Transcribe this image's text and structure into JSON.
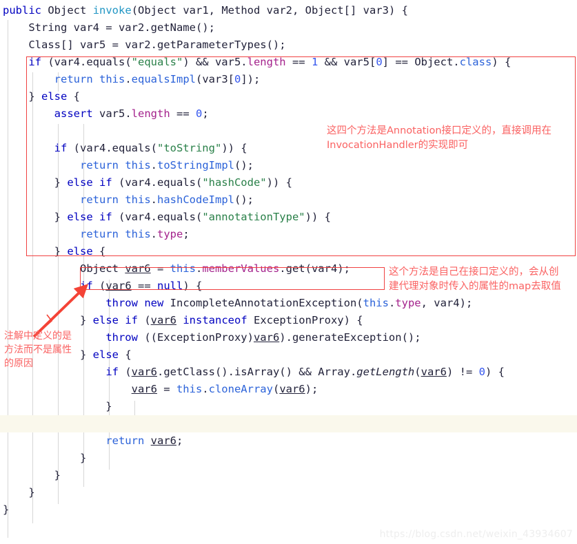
{
  "editor": {
    "language": "java",
    "background": "#ffffff",
    "highlighted_line_color": "#faf8ec",
    "lines": [
      {
        "indent": 0,
        "text": "public Object invoke(Object var1, Method var2, Object[] var3) {"
      },
      {
        "indent": 1,
        "text": "String var4 = var2.getName();"
      },
      {
        "indent": 1,
        "text": "Class[] var5 = var2.getParameterTypes();"
      },
      {
        "indent": 1,
        "text": "if (var4.equals(\"equals\") && var5.length == 1 && var5[0] == Object.class) {"
      },
      {
        "indent": 2,
        "text": "return this.equalsImpl(var3[0]);"
      },
      {
        "indent": 1,
        "text": "} else {"
      },
      {
        "indent": 2,
        "text": "assert var5.length == 0;"
      },
      {
        "indent": 0,
        "text": ""
      },
      {
        "indent": 2,
        "text": "if (var4.equals(\"toString\")) {"
      },
      {
        "indent": 3,
        "text": "return this.toStringImpl();"
      },
      {
        "indent": 2,
        "text": "} else if (var4.equals(\"hashCode\")) {"
      },
      {
        "indent": 3,
        "text": "return this.hashCodeImpl();"
      },
      {
        "indent": 2,
        "text": "} else if (var4.equals(\"annotationType\")) {"
      },
      {
        "indent": 3,
        "text": "return this.type;"
      },
      {
        "indent": 2,
        "text": "} else {"
      },
      {
        "indent": 3,
        "text": "Object var6 = this.memberValues.get(var4);"
      },
      {
        "indent": 3,
        "text": "if (var6 == null) {"
      },
      {
        "indent": 4,
        "text": "throw new IncompleteAnnotationException(this.type, var4);"
      },
      {
        "indent": 3,
        "text": "} else if (var6 instanceof ExceptionProxy) {"
      },
      {
        "indent": 4,
        "text": "throw ((ExceptionProxy)var6).generateException();"
      },
      {
        "indent": 3,
        "text": "} else {"
      },
      {
        "indent": 4,
        "text": "if (var6.getClass().isArray() && Array.getLength(var6) != 0) {"
      },
      {
        "indent": 5,
        "text": "var6 = this.cloneArray(var6);"
      },
      {
        "indent": 4,
        "text": "}"
      },
      {
        "indent": 0,
        "text": ""
      },
      {
        "indent": 4,
        "text": "return var6;"
      },
      {
        "indent": 3,
        "text": "}"
      },
      {
        "indent": 2,
        "text": "}"
      },
      {
        "indent": 1,
        "text": "}"
      },
      {
        "indent": 0,
        "text": "}"
      }
    ],
    "highlighted_line_index": 24
  },
  "annotations": {
    "color": "#fa6262",
    "box_color": "#f04040",
    "items": [
      {
        "id": "annotation-annotation-interface",
        "text": "这四个方法是Annotation接口定义的，直接调用在\nInvocationHandler的实现即可"
      },
      {
        "id": "annotation-member-values",
        "text": "这个方法是自己在接口定义的，会从创\n建代理对象时传入的属性的map去取值"
      },
      {
        "id": "annotation-method-not-field",
        "text": "注解中定义的是\n方法而不是属性\n的原因"
      }
    ]
  },
  "watermark": {
    "text": "https://blog.csdn.net/weixin_43934607"
  }
}
